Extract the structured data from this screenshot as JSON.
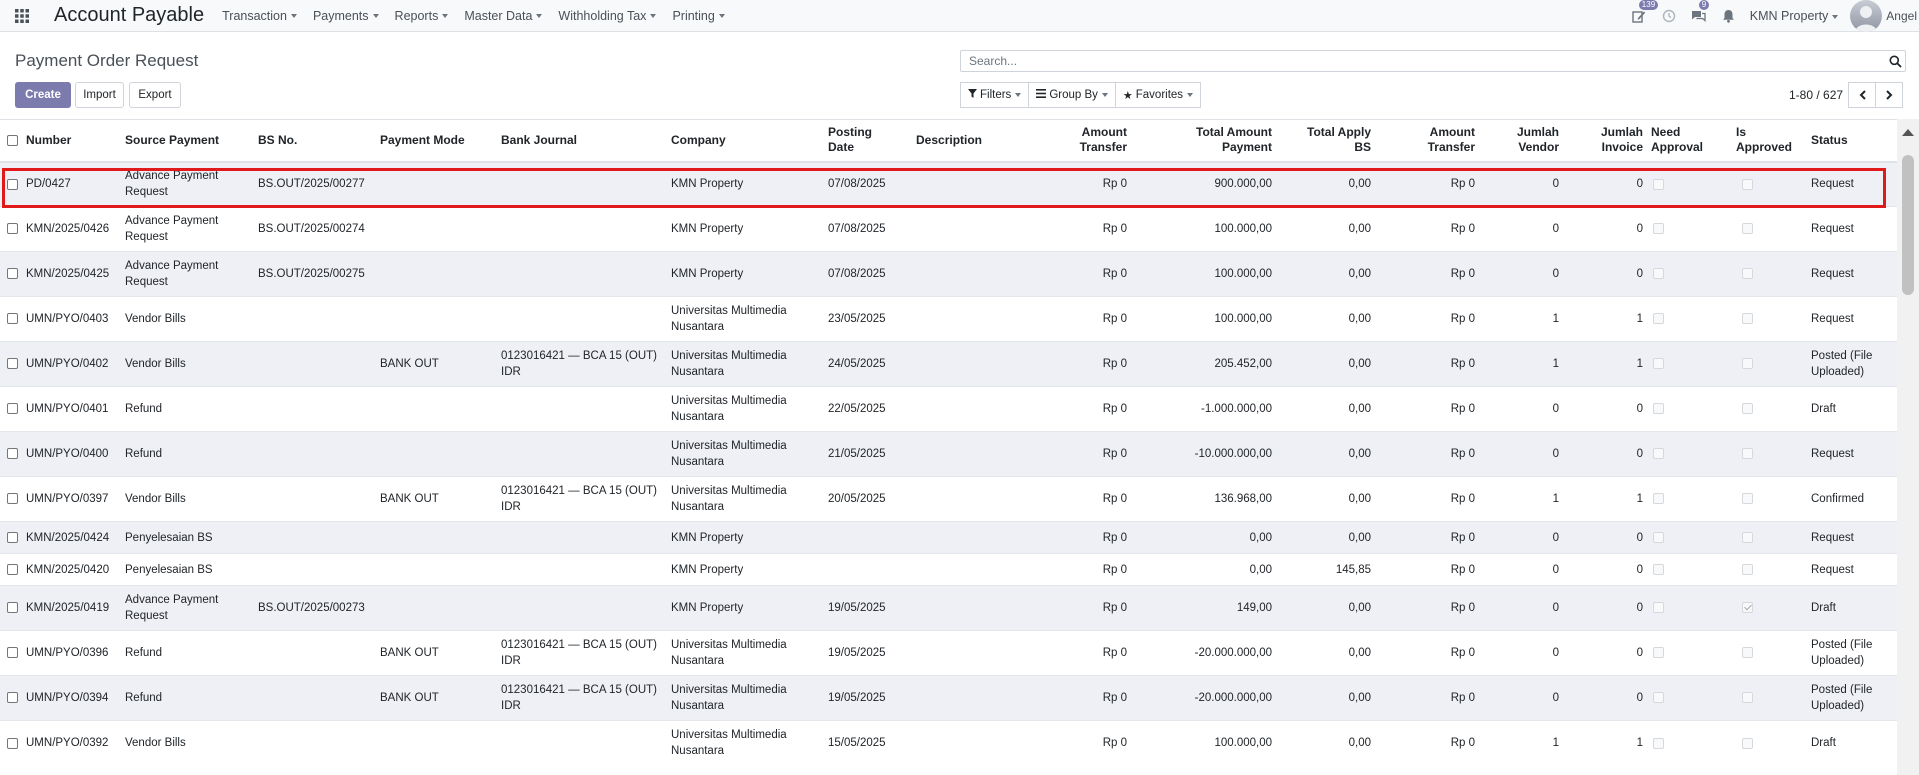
{
  "app": {
    "title": "Account Payable",
    "menus": [
      "Transaction",
      "Payments",
      "Reports",
      "Master Data",
      "Withholding Tax",
      "Printing"
    ],
    "activity_badge": "139",
    "messages_badge": "9",
    "company": "KMN Property",
    "user": "Angel"
  },
  "page": {
    "title": "Payment Order Request",
    "create_label": "Create",
    "import_label": "Import",
    "export_label": "Export",
    "search_placeholder": "Search...",
    "filters_label": "Filters",
    "groupby_label": "Group By",
    "favorites_label": "Favorites",
    "pager": "1-80 / 627"
  },
  "table": {
    "headers": {
      "number": "Number",
      "source_payment": "Source Payment",
      "bs_no": "BS No.",
      "payment_mode": "Payment Mode",
      "bank_journal": "Bank Journal",
      "company": "Company",
      "posting_date": [
        "Posting",
        "Date"
      ],
      "description": "Description",
      "amount_transfer": [
        "Amount",
        "Transfer"
      ],
      "total_amount_payment": [
        "Total Amount",
        "Payment"
      ],
      "total_apply_bs": [
        "Total Apply",
        "BS"
      ],
      "amount_transfer_2": [
        "Amount",
        "Transfer"
      ],
      "jumlah_vendor": [
        "Jumlah",
        "Vendor"
      ],
      "jumlah_invoice": [
        "Jumlah",
        "Invoice"
      ],
      "need_approval": [
        "Need",
        "Approval"
      ],
      "is_approved": [
        "Is",
        "Approved"
      ],
      "status": "Status"
    },
    "rows": [
      {
        "number": "PD/0427",
        "source": "Advance Payment Request",
        "bs_no": "BS.OUT/2025/00277",
        "mode": "",
        "journal": "",
        "company": "KMN Property",
        "date": "07/08/2025",
        "desc": "",
        "amt": "Rp 0",
        "total": "900.000,00",
        "apply": "0,00",
        "amt2": "Rp 0",
        "vendor": "0",
        "invoice": "0",
        "need": false,
        "approved": false,
        "status": "Request"
      },
      {
        "number": "KMN/2025/0426",
        "source": "Advance Payment Request",
        "bs_no": "BS.OUT/2025/00274",
        "mode": "",
        "journal": "",
        "company": "KMN Property",
        "date": "07/08/2025",
        "desc": "",
        "amt": "Rp 0",
        "total": "100.000,00",
        "apply": "0,00",
        "amt2": "Rp 0",
        "vendor": "0",
        "invoice": "0",
        "need": false,
        "approved": false,
        "status": "Request"
      },
      {
        "number": "KMN/2025/0425",
        "source": "Advance Payment Request",
        "bs_no": "BS.OUT/2025/00275",
        "mode": "",
        "journal": "",
        "company": "KMN Property",
        "date": "07/08/2025",
        "desc": "",
        "amt": "Rp 0",
        "total": "100.000,00",
        "apply": "0,00",
        "amt2": "Rp 0",
        "vendor": "0",
        "invoice": "0",
        "need": false,
        "approved": false,
        "status": "Request"
      },
      {
        "number": "UMN/PYO/0403",
        "source": "Vendor Bills",
        "bs_no": "",
        "mode": "",
        "journal": "",
        "company": "Universitas Multimedia Nusantara",
        "date": "23/05/2025",
        "desc": "",
        "amt": "Rp 0",
        "total": "100.000,00",
        "apply": "0,00",
        "amt2": "Rp 0",
        "vendor": "1",
        "invoice": "1",
        "need": false,
        "approved": false,
        "status": "Request"
      },
      {
        "number": "UMN/PYO/0402",
        "source": "Vendor Bills",
        "bs_no": "",
        "mode": "BANK OUT",
        "journal": "0123016421 — BCA 15 (OUT) IDR",
        "company": "Universitas Multimedia Nusantara",
        "date": "24/05/2025",
        "desc": "",
        "amt": "Rp 0",
        "total": "205.452,00",
        "apply": "0,00",
        "amt2": "Rp 0",
        "vendor": "1",
        "invoice": "1",
        "need": false,
        "approved": false,
        "status": "Posted (File Uploaded)"
      },
      {
        "number": "UMN/PYO/0401",
        "source": "Refund",
        "bs_no": "",
        "mode": "",
        "journal": "",
        "company": "Universitas Multimedia Nusantara",
        "date": "22/05/2025",
        "desc": "",
        "amt": "Rp 0",
        "total": "-1.000.000,00",
        "apply": "0,00",
        "amt2": "Rp 0",
        "vendor": "0",
        "invoice": "0",
        "need": false,
        "approved": false,
        "status": "Draft"
      },
      {
        "number": "UMN/PYO/0400",
        "source": "Refund",
        "bs_no": "",
        "mode": "",
        "journal": "",
        "company": "Universitas Multimedia Nusantara",
        "date": "21/05/2025",
        "desc": "",
        "amt": "Rp 0",
        "total": "-10.000.000,00",
        "apply": "0,00",
        "amt2": "Rp 0",
        "vendor": "0",
        "invoice": "0",
        "need": false,
        "approved": false,
        "status": "Request"
      },
      {
        "number": "UMN/PYO/0397",
        "source": "Vendor Bills",
        "bs_no": "",
        "mode": "BANK OUT",
        "journal": "0123016421 — BCA 15 (OUT) IDR",
        "company": "Universitas Multimedia Nusantara",
        "date": "20/05/2025",
        "desc": "",
        "amt": "Rp 0",
        "total": "136.968,00",
        "apply": "0,00",
        "amt2": "Rp 0",
        "vendor": "1",
        "invoice": "1",
        "need": false,
        "approved": false,
        "status": "Confirmed"
      },
      {
        "number": "KMN/2025/0424",
        "source": "Penyelesaian BS",
        "bs_no": "",
        "mode": "",
        "journal": "",
        "company": "KMN Property",
        "date": "",
        "desc": "",
        "amt": "Rp 0",
        "total": "0,00",
        "apply": "0,00",
        "amt2": "Rp 0",
        "vendor": "0",
        "invoice": "0",
        "need": false,
        "approved": false,
        "status": "Request"
      },
      {
        "number": "KMN/2025/0420",
        "source": "Penyelesaian BS",
        "bs_no": "",
        "mode": "",
        "journal": "",
        "company": "KMN Property",
        "date": "",
        "desc": "",
        "amt": "Rp 0",
        "total": "0,00",
        "apply": "145,85",
        "amt2": "Rp 0",
        "vendor": "0",
        "invoice": "0",
        "need": false,
        "approved": false,
        "status": "Request"
      },
      {
        "number": "KMN/2025/0419",
        "source": "Advance Payment Request",
        "bs_no": "BS.OUT/2025/00273",
        "mode": "",
        "journal": "",
        "company": "KMN Property",
        "date": "19/05/2025",
        "desc": "",
        "amt": "Rp 0",
        "total": "149,00",
        "apply": "0,00",
        "amt2": "Rp 0",
        "vendor": "0",
        "invoice": "0",
        "need": false,
        "approved": true,
        "status": "Draft"
      },
      {
        "number": "UMN/PYO/0396",
        "source": "Refund",
        "bs_no": "",
        "mode": "BANK OUT",
        "journal": "0123016421 — BCA 15 (OUT) IDR",
        "company": "Universitas Multimedia Nusantara",
        "date": "19/05/2025",
        "desc": "",
        "amt": "Rp 0",
        "total": "-20.000.000,00",
        "apply": "0,00",
        "amt2": "Rp 0",
        "vendor": "0",
        "invoice": "0",
        "need": false,
        "approved": false,
        "status": "Posted (File Uploaded)"
      },
      {
        "number": "UMN/PYO/0394",
        "source": "Refund",
        "bs_no": "",
        "mode": "BANK OUT",
        "journal": "0123016421 — BCA 15 (OUT) IDR",
        "company": "Universitas Multimedia Nusantara",
        "date": "19/05/2025",
        "desc": "",
        "amt": "Rp 0",
        "total": "-20.000.000,00",
        "apply": "0,00",
        "amt2": "Rp 0",
        "vendor": "0",
        "invoice": "0",
        "need": false,
        "approved": false,
        "status": "Posted (File Uploaded)"
      },
      {
        "number": "UMN/PYO/0392",
        "source": "Vendor Bills",
        "bs_no": "",
        "mode": "",
        "journal": "",
        "company": "Universitas Multimedia Nusantara",
        "date": "15/05/2025",
        "desc": "",
        "amt": "Rp 0",
        "total": "100.000,00",
        "apply": "0,00",
        "amt2": "Rp 0",
        "vendor": "1",
        "invoice": "1",
        "need": false,
        "approved": false,
        "status": "Draft"
      }
    ]
  },
  "colors": {
    "primary": "#7c7bad",
    "highlight": "#e01a1a",
    "row_stripe": "#eef0f5"
  },
  "icons": [
    "apps-grid-icon",
    "edit-activity-icon",
    "clock-icon",
    "chat-icon",
    "bell-icon",
    "search-icon",
    "filter-icon",
    "list-icon",
    "star-icon",
    "chevron-left-icon",
    "chevron-right-icon"
  ]
}
